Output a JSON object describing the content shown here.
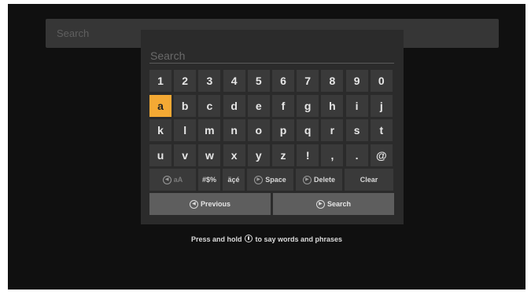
{
  "search_bar": {
    "placeholder": "Search"
  },
  "keyboard": {
    "field_placeholder": "Search",
    "rows": [
      [
        "1",
        "2",
        "3",
        "4",
        "5",
        "6",
        "7",
        "8",
        "9",
        "0"
      ],
      [
        "a",
        "b",
        "c",
        "d",
        "e",
        "f",
        "g",
        "h",
        "i",
        "j"
      ],
      [
        "k",
        "l",
        "m",
        "n",
        "o",
        "p",
        "q",
        "r",
        "s",
        "t"
      ],
      [
        "u",
        "v",
        "w",
        "x",
        "y",
        "z",
        "!",
        ",",
        ".",
        "@"
      ]
    ],
    "selected_key": "a",
    "function_keys": {
      "case_toggle": "aA",
      "symbols": "#$%",
      "accents": "äçé",
      "space": "Space",
      "delete": "Delete",
      "clear": "Clear"
    }
  },
  "actions": {
    "previous": "Previous",
    "search": "Search"
  },
  "hint": {
    "before_icon": "Press and hold",
    "after_icon": "to say words and phrases"
  },
  "icons": {
    "case_toggle": "rewind-button-icon",
    "space": "play-pause-button-icon",
    "delete": "play-pause-button-icon",
    "previous": "rewind-button-icon",
    "search": "play-pause-button-icon",
    "hint": "microphone-icon"
  },
  "colors": {
    "selected_key": "#f4a934",
    "key_background": "#3a3a3a",
    "action_background": "#5e5e5e"
  }
}
